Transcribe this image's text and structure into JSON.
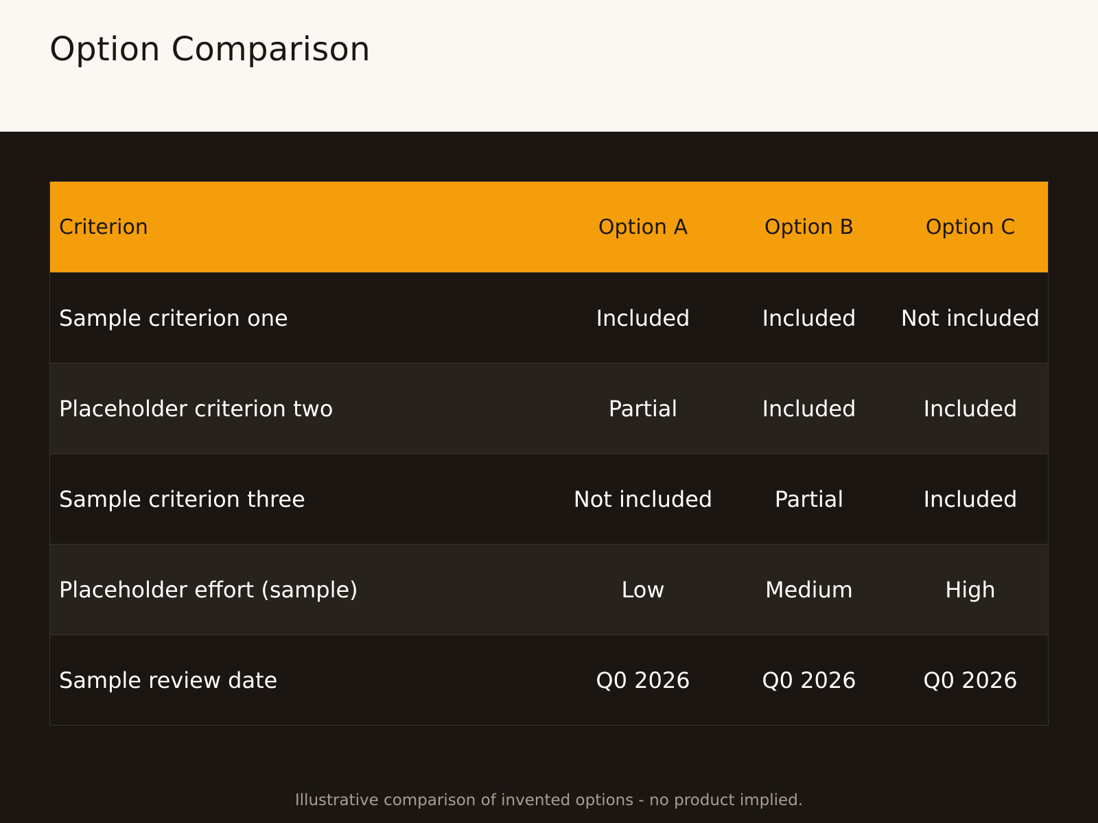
{
  "page": {
    "title": "Option Comparison",
    "footnote": "Illustrative comparison of invented options  -  no product implied."
  },
  "colors": {
    "header_band": "#fbf8f3",
    "background": "#1b1612",
    "accent": "#f59e0b",
    "row_alt": "#28221d"
  },
  "table": {
    "headers": [
      "Criterion",
      "Option A",
      "Option B",
      "Option C"
    ],
    "rows": [
      [
        "Sample criterion one",
        "Included",
        "Included",
        "Not included"
      ],
      [
        "Placeholder criterion two",
        "Partial",
        "Included",
        "Included"
      ],
      [
        "Sample criterion three",
        "Not included",
        "Partial",
        "Included"
      ],
      [
        "Placeholder effort (sample)",
        "Low",
        "Medium",
        "High"
      ],
      [
        "Sample review date",
        "Q0 2026",
        "Q0 2026",
        "Q0 2026"
      ]
    ]
  }
}
